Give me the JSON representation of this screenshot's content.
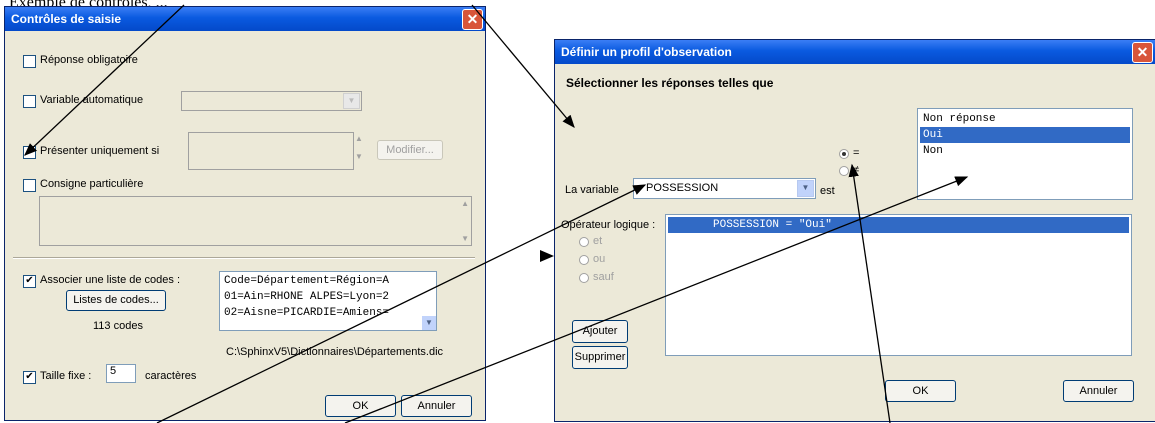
{
  "page": {
    "heading_fragment": "Exemple de contrôles, ..."
  },
  "left_dialog": {
    "title": "Contrôles de saisie",
    "close_glyph": "✕",
    "reponse_obligatoire": {
      "label": "Réponse obligatoire",
      "checked": false
    },
    "variable_automatique": {
      "label": "Variable automatique",
      "checked": false,
      "value": ""
    },
    "presenter_uniquement_si": {
      "label": "Présenter uniquement si",
      "checked": false,
      "value": "",
      "modify_button": "Modifier..."
    },
    "consigne_particuliere": {
      "label": "Consigne particulière",
      "checked": false,
      "value": ""
    },
    "associer_liste": {
      "label": "Associer une liste de codes :",
      "checked": true
    },
    "liste_codes_button": "Listes de codes...",
    "codes_count": "113 codes",
    "codes_lines": [
      "Code=Département=Région=A",
      "01=Ain=RHONE ALPES=Lyon=2",
      "02=Aisne=PICARDIE=Amiens="
    ],
    "file_path": "C:\\SphinxV5\\Dictionnaires\\Départements.dic",
    "taille_fixe": {
      "label": "Taille fixe :",
      "checked": true,
      "value": "5",
      "unit": "caractères"
    },
    "ok_button": "OK",
    "cancel_button": "Annuler"
  },
  "right_dialog": {
    "title": "Définir un profil d'observation",
    "close_glyph": "✕",
    "heading": "Sélectionner les réponses telles que",
    "variable_label": "La variable",
    "variable_value": "POSSESSION",
    "est_label": "est",
    "op_equal": "=",
    "op_notequal": "≠",
    "responses": [
      "Non réponse",
      "Oui",
      "Non"
    ],
    "selected_response": "Oui",
    "logic_label": "Opérateur logique :",
    "logic_options": [
      "et",
      "ou",
      "sauf"
    ],
    "ajouter_button": "Ajouter",
    "supprimer_button": "Supprimer",
    "expression": "POSSESSION = \"Oui\"",
    "ok_button": "OK",
    "cancel_button": "Annuler"
  }
}
